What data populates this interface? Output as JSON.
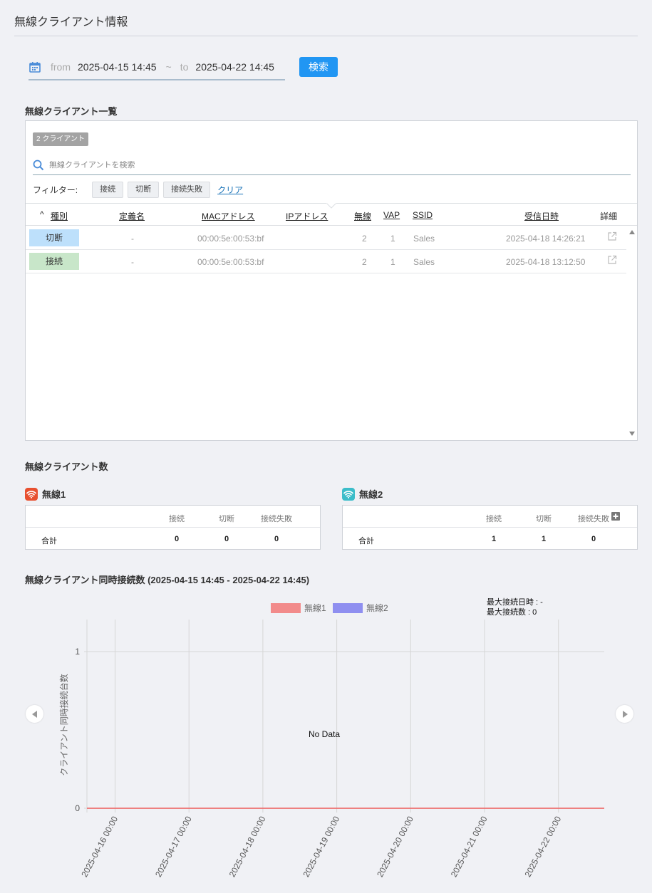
{
  "page_title": "無線クライアント情報",
  "date_range": {
    "from_label": "from",
    "from_value": "2025-04-15 14:45",
    "separator": "~",
    "to_label": "to",
    "to_value": "2025-04-22 14:45"
  },
  "search_button": "検索",
  "client_list": {
    "heading": "無線クライアント一覧",
    "count_badge": "2 クライアント",
    "search_placeholder": "無線クライアントを検索",
    "filter_label": "フィルター:",
    "filters": [
      "接続",
      "切断",
      "接続失敗"
    ],
    "clear_label": "クリア",
    "columns": {
      "sort_caret": "^",
      "type": "種別",
      "name": "定義名",
      "mac": "MACアドレス",
      "ip": "IPアドレス",
      "radio": "無線",
      "vap": "VAP",
      "ssid": "SSID",
      "received": "受信日時",
      "detail": "詳細"
    },
    "rows": [
      {
        "type": "切断",
        "type_color": "#bde0fb",
        "name": "-",
        "mac": "00:00:5e:00:53:bf",
        "ip": "",
        "radio": "2",
        "vap": "1",
        "ssid": "Sales",
        "received": "2025-04-18 14:26:21"
      },
      {
        "type": "接続",
        "type_color": "#c8e6c9",
        "name": "-",
        "mac": "00:00:5e:00:53:bf",
        "ip": "",
        "radio": "2",
        "vap": "1",
        "ssid": "Sales",
        "received": "2025-04-18 13:12:50"
      }
    ]
  },
  "client_count": {
    "heading": "無線クライアント数",
    "radio1": {
      "title": "無線1",
      "icon_color": "#e8502f",
      "headers": [
        "接続",
        "切断",
        "接続失敗"
      ],
      "row_label": "合計",
      "values": [
        "0",
        "0",
        "0"
      ]
    },
    "radio2": {
      "title": "無線2",
      "icon_color": "#3bbdc9",
      "headers": [
        "接続",
        "切断",
        "接続失敗"
      ],
      "row_label": "合計",
      "values": [
        "1",
        "1",
        "0"
      ]
    }
  },
  "concurrent": {
    "heading": "無線クライアント同時接続数 (2025-04-15 14:45 - 2025-04-22 14:45)",
    "max_time": "最大接続日時 : -",
    "max_count": "最大接続数 : 0",
    "no_data": "No Data"
  },
  "chart_data": {
    "type": "line",
    "ylabel": "クライアント同時接続台数",
    "xlabel": "",
    "ylim": [
      0,
      1
    ],
    "y_ticks": [
      "0",
      "1"
    ],
    "categories": [
      "2025-04-16 00:00",
      "2025-04-17 00:00",
      "2025-04-18 00:00",
      "2025-04-19 00:00",
      "2025-04-20 00:00",
      "2025-04-21 00:00",
      "2025-04-22 00:00"
    ],
    "series": [
      {
        "name": "無線1",
        "color": "#f28b8b",
        "values": [
          0,
          0,
          0,
          0,
          0,
          0,
          0
        ]
      },
      {
        "name": "無線2",
        "color": "#8f8ff0",
        "values": []
      }
    ],
    "grid": true,
    "legend": "top-center"
  },
  "icons": {
    "calendar": "calendar-icon",
    "search": "search-icon",
    "external": "external-link-icon",
    "plus": "plus-icon",
    "wifi": "wifi-icon",
    "prev": "chevron-left-icon",
    "next": "chevron-right-icon"
  }
}
